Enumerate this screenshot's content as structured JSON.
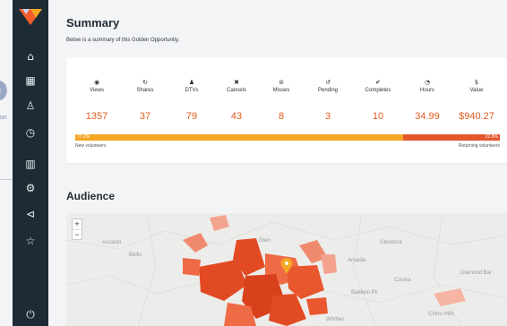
{
  "page": {
    "title": "Summary",
    "subtitle": "Below is a summary of this Golden Opportunity."
  },
  "fragment": {
    "big": "o",
    "small": "on"
  },
  "nav": [
    {
      "icon": "home-icon",
      "glyph": "⌂"
    },
    {
      "icon": "grid-icon",
      "glyph": "▦"
    },
    {
      "icon": "user-icon",
      "glyph": "♙"
    },
    {
      "icon": "stopwatch-icon",
      "glyph": "◷"
    },
    {
      "icon": "bar-chart-icon",
      "glyph": "▥"
    },
    {
      "icon": "gear-icon",
      "glyph": "⚙"
    },
    {
      "icon": "megaphone-icon",
      "glyph": "⊲"
    },
    {
      "icon": "star-icon",
      "glyph": "☆"
    },
    {
      "icon": "power-icon",
      "glyph": "⏻"
    }
  ],
  "summary": {
    "stats": [
      {
        "icon": "eye-icon",
        "glyph": "◉",
        "label": "Views",
        "value": "1357"
      },
      {
        "icon": "share-icon",
        "glyph": "↻",
        "label": "Shares",
        "value": "37"
      },
      {
        "icon": "person-icon",
        "glyph": "♟",
        "label": "DTVs",
        "value": "79"
      },
      {
        "icon": "x-icon",
        "glyph": "✖",
        "label": "Cancels",
        "value": "43"
      },
      {
        "icon": "circle-slash-icon",
        "glyph": "⊘",
        "label": "Misses",
        "value": "8"
      },
      {
        "icon": "refresh-icon",
        "glyph": "↺",
        "label": "Pending",
        "value": "3"
      },
      {
        "icon": "check-icon",
        "glyph": "✔",
        "label": "Completes",
        "value": "10"
      },
      {
        "icon": "clock-icon",
        "glyph": "◔",
        "label": "Hours",
        "value": "34.99"
      },
      {
        "icon": "dollar-icon",
        "glyph": "$",
        "label": "Value",
        "value": "$940.27"
      }
    ],
    "split": {
      "new_pct": 77.2,
      "new_label": "77.2%",
      "returning_label": "22.8%",
      "new_caption": "New volunteers",
      "returning_caption": "Returning volunteers"
    }
  },
  "audience": {
    "title": "Audience",
    "zoom_in": "+",
    "zoom_out": "−",
    "map_labels": [
      "Ascalon",
      "Glen",
      "Bellis",
      "Arcadia",
      "Glendora",
      "Covina",
      "Baldwin Pk",
      "Diamond Bar",
      "Chino Hills",
      "Whittier"
    ]
  },
  "colors": {
    "sidebar": "#1d2b34",
    "accent_orange": "#f5a623",
    "accent_red": "#e4572e",
    "value_text": "#e05a1f"
  }
}
